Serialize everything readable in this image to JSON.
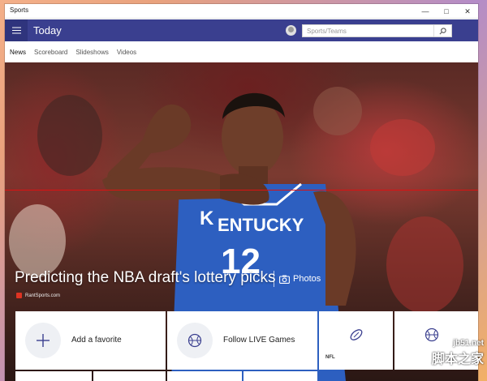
{
  "window": {
    "title": "Sports",
    "controls": [
      "minimize-icon",
      "maximize-icon",
      "close-icon"
    ]
  },
  "header": {
    "page_title": "Today",
    "search_placeholder": "Sports/Teams",
    "accent": "#3a3f8f"
  },
  "tabs": [
    {
      "label": "News",
      "active": true
    },
    {
      "label": "Scoreboard",
      "active": false
    },
    {
      "label": "Slideshows",
      "active": false
    },
    {
      "label": "Videos",
      "active": false
    }
  ],
  "hero": {
    "headline": "Predicting the NBA draft's lottery picks",
    "media_label": "Photos",
    "source": "RantSports.com",
    "jersey_text": "KENTUCKY",
    "jersey_number": "12"
  },
  "tiles": [
    {
      "label": "Add a favorite",
      "icon": "plus-icon"
    },
    {
      "label": "Follow LIVE Games",
      "icon": "basketball-icon"
    },
    {
      "label": "NFL",
      "icon": "football-icon"
    },
    {
      "label": "",
      "icon": "basketball-icon"
    }
  ],
  "watermark": {
    "line1": "jb51.net",
    "line2": "脚本之家"
  }
}
